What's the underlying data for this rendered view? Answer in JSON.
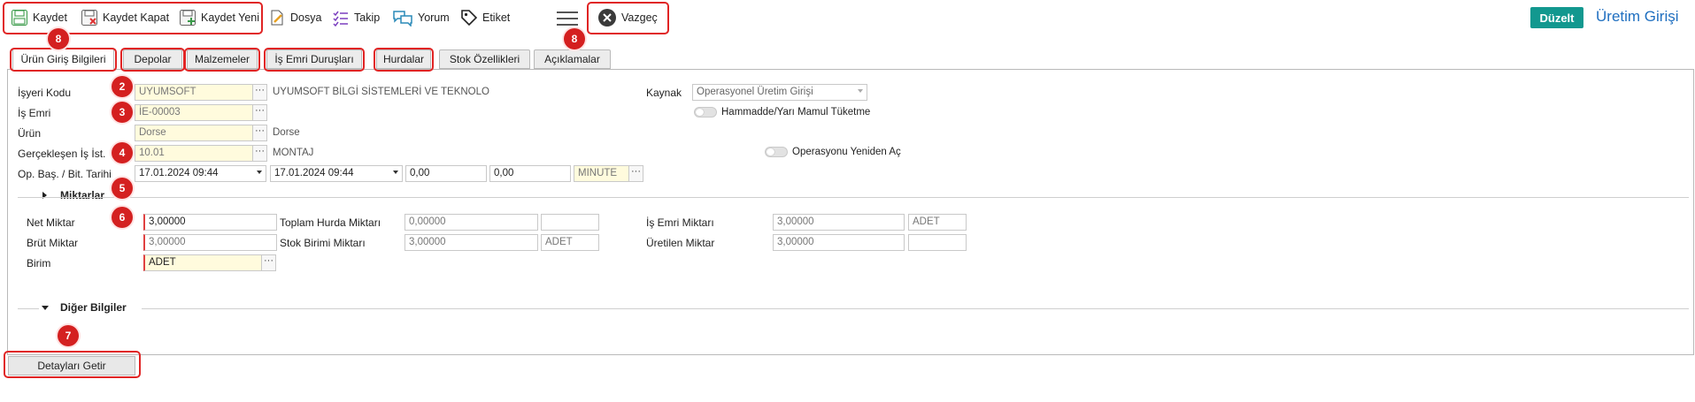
{
  "toolbar": {
    "save": "Kaydet",
    "save_close": "Kaydet Kapat",
    "save_new": "Kaydet Yeni",
    "file": "Dosya",
    "follow": "Takip",
    "comment": "Yorum",
    "tag": "Etiket",
    "cancel": "Vazgeç",
    "edit": "Düzelt",
    "page_title": "Üretim Girişi"
  },
  "tabs": [
    {
      "label": "Ürün Giriş Bilgileri",
      "active": true
    },
    {
      "label": "Depolar"
    },
    {
      "label": "Malzemeler"
    },
    {
      "label": "İş Emri Duruşları"
    },
    {
      "label": "Hurdalar"
    },
    {
      "label": "Stok Özellikleri"
    },
    {
      "label": "Açıklamalar"
    }
  ],
  "form": {
    "workplace_label": "İşyeri Kodu",
    "workplace_value": "UYUMSOFT",
    "workplace_name": "UYUMSOFT BİLGİ SİSTEMLERİ VE TEKNOLO",
    "work_order_label": "İş Emri",
    "work_order_value": "İE-00003",
    "product_label": "Ürün",
    "product_value": "Dorse",
    "product_name": "Dorse",
    "station_label": "Gerçekleşen İş İst.",
    "station_value": "10.01",
    "station_name": "MONTAJ",
    "op_dates_label": "Op. Baş. / Bit. Tarihi",
    "op_start": "17.01.2024 09:44",
    "op_end": "17.01.2024 09:44",
    "op_val1": "0,00",
    "op_val2": "0,00",
    "op_unit": "MINUTE",
    "source_label": "Kaynak",
    "source_value": "Operasyonel Üretim Girişi",
    "consume_toggle": "Hammadde/Yarı Mamul Tüketme",
    "reopen_toggle": "Operasyonu Yeniden Aç"
  },
  "quantities": {
    "section_title": "Miktarlar",
    "net_label": "Net Miktar",
    "net_value": "3,00000",
    "gross_label": "Brüt Miktar",
    "gross_value": "3,00000",
    "unit_label": "Birim",
    "unit_value": "ADET",
    "scrap_total_label": "Toplam Hurda Miktarı",
    "scrap_total_value": "0,00000",
    "stock_unit_qty_label": "Stok Birimi Miktarı",
    "stock_unit_qty_value": "3,00000",
    "stock_unit": "ADET",
    "wo_qty_label": "İş Emri Miktarı",
    "wo_qty_value": "3,00000",
    "wo_qty_unit": "ADET",
    "produced_label": "Üretilen Miktar",
    "produced_value": "3,00000"
  },
  "other": {
    "section_title": "Diğer Bilgiler"
  },
  "details_button": "Detayları Getir",
  "badges": [
    "8",
    "2",
    "3",
    "4",
    "5",
    "6",
    "7",
    "8"
  ],
  "colors": {
    "accent": "#12988f",
    "title": "#1f6fc0",
    "annotation": "#e02424"
  }
}
